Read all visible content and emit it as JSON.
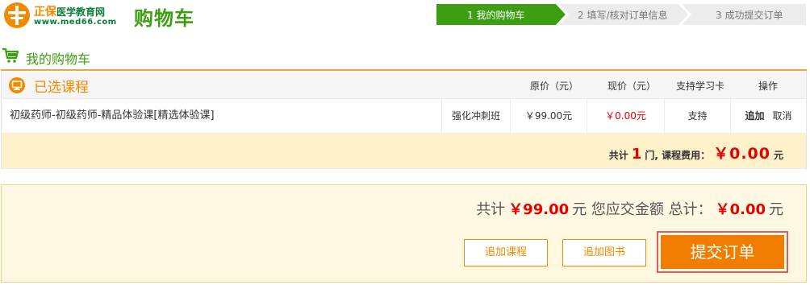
{
  "brand": {
    "short_name": "正保",
    "site_name": "医学教育网",
    "url": "www.med66.com"
  },
  "page_title": "购物车",
  "steps": [
    {
      "label": "1  我的购物车",
      "active": true
    },
    {
      "label": "2  填写/核对订单信息",
      "active": false
    },
    {
      "label": "3  成功提交订单",
      "active": false
    }
  ],
  "my_cart_label": "我的购物车",
  "table": {
    "section_title": "已选课程",
    "headers": {
      "original_price": "原价（元）",
      "current_price": "现价（元）",
      "study_card": "支持学习卡",
      "actions": "操作"
    },
    "rows": [
      {
        "course_name": "初级药师-初级药师-精品体验课[精选体验课]",
        "class_type": "强化冲刺班",
        "original_price": "￥99.00元",
        "current_price": "￥0.00元",
        "study_card": "支持",
        "add_label": "追加",
        "cancel_label": "取消"
      }
    ],
    "footer": {
      "prefix": "共计",
      "count": "1",
      "mid": "门, 课程费用：",
      "fee": "￥0.00",
      "unit": "元"
    }
  },
  "summary": {
    "prefix": "共计",
    "original_total": "￥99.00",
    "mid": "元 您应交金额 总计：",
    "pay_total": "￥0.00",
    "unit": "元"
  },
  "buttons": {
    "add_course": "追加课程",
    "add_book": "追加图书",
    "submit": "提交订单"
  },
  "colors": {
    "brand_green": "#3d9e12",
    "accent_orange": "#f08a00",
    "price_red": "#e60000",
    "highlight_border": "#e85a5a"
  }
}
